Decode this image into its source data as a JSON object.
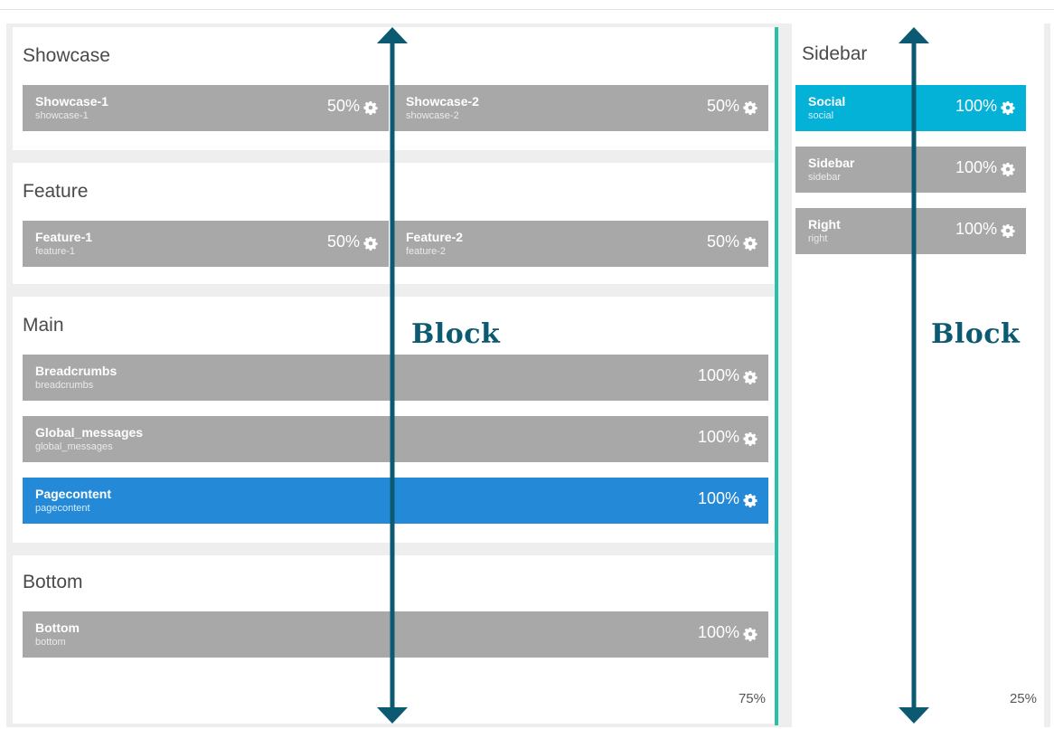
{
  "sections": {
    "showcase": {
      "title": "Showcase",
      "cards": [
        {
          "title": "Showcase-1",
          "sub": "showcase-1",
          "pct": "50%"
        },
        {
          "title": "Showcase-2",
          "sub": "showcase-2",
          "pct": "50%"
        }
      ]
    },
    "feature": {
      "title": "Feature",
      "cards": [
        {
          "title": "Feature-1",
          "sub": "feature-1",
          "pct": "50%"
        },
        {
          "title": "Feature-2",
          "sub": "feature-2",
          "pct": "50%"
        }
      ]
    },
    "main": {
      "title": "Main",
      "cards": [
        {
          "title": "Breadcrumbs",
          "sub": "breadcrumbs",
          "pct": "100%"
        },
        {
          "title": "Global_messages",
          "sub": "global_messages",
          "pct": "100%"
        },
        {
          "title": "Pagecontent",
          "sub": "pagecontent",
          "pct": "100%"
        }
      ]
    },
    "bottom": {
      "title": "Bottom",
      "cards": [
        {
          "title": "Bottom",
          "sub": "bottom",
          "pct": "100%"
        }
      ]
    },
    "sidebar": {
      "title": "Sidebar",
      "cards": [
        {
          "title": "Social",
          "sub": "social",
          "pct": "100%"
        },
        {
          "title": "Sidebar",
          "sub": "sidebar",
          "pct": "100%"
        },
        {
          "title": "Right",
          "sub": "right",
          "pct": "100%"
        }
      ]
    }
  },
  "column_widths": {
    "left": "75%",
    "right": "25%"
  },
  "annotations": {
    "block_left": "Block",
    "block_right": "Block"
  },
  "colors": {
    "card_gray": "#a8a8a8",
    "card_blue": "#2489d6",
    "card_cyan": "#04b2d8",
    "arrow": "#0c5a72",
    "divider": "#28c0a8"
  },
  "icons": {
    "card_settings": "gear-icon"
  }
}
